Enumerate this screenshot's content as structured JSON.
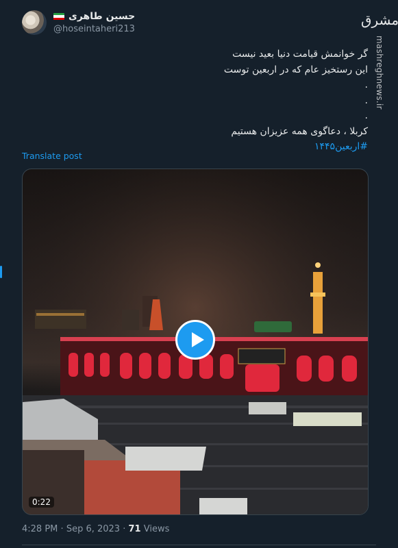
{
  "tweet": {
    "author": {
      "display_name": "حسین طاهری",
      "flag_icon": "iran-flag-icon",
      "handle": "@hoseintaheri213"
    },
    "text_lines": [
      "گر خوانمش قیامت دنیا بعید نیست",
      "این رستخیز عام که در اربعین توست",
      ".",
      ".",
      ".",
      "کربلا ، دعاگوی همه عزیزان هستیم"
    ],
    "hashtag": "#اربعین۱۴۴۵",
    "translate_label": "Translate post",
    "video": {
      "duration": "0:22",
      "play_icon": "play-icon"
    },
    "meta": {
      "time": "4:28 PM",
      "separator": "·",
      "date": "Sep 6, 2023",
      "views_count": "71",
      "views_label": "Views"
    }
  },
  "watermark": {
    "logo_text": "مشرق",
    "url": "mashreghnews.ir"
  },
  "colors": {
    "background": "#15202b",
    "accent": "#1d9bf0",
    "text": "#e7e9ea",
    "muted": "#8b98a5"
  }
}
